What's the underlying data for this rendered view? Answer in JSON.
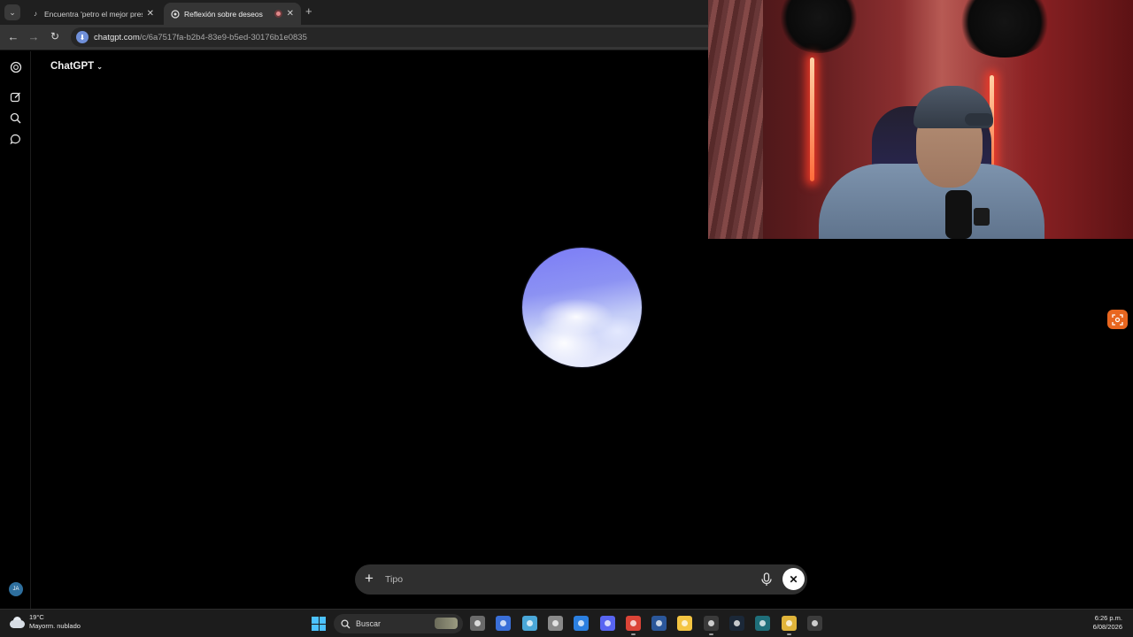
{
  "browser": {
    "tabs": [
      {
        "title": "Encuentra 'petro el mejor presi",
        "close": "✕",
        "active": false
      },
      {
        "title": "Reflexión sobre deseos",
        "close": "✕",
        "active": true
      }
    ],
    "new_tab": "+",
    "url_host": "chatgpt.com",
    "url_path": "/c/6a7517fa-b2b4-83e9-b5ed-30176b1e0835"
  },
  "app": {
    "model_label": "ChatGPT",
    "composer_placeholder": "Tipo",
    "avatar_initials": "JA",
    "orb_color": "#8a8ff5"
  },
  "taskbar": {
    "weather_temp": "19°C",
    "weather_desc": "Mayorm. nublado",
    "search_label": "Buscar",
    "apps": [
      {
        "name": "task-view",
        "icon": "task-view-icon",
        "color": "#6a6a6a"
      },
      {
        "name": "microsoft-store",
        "icon": "store-icon",
        "color": "#3a6fd8"
      },
      {
        "name": "photos",
        "icon": "photos-icon",
        "color": "#4aa7d8"
      },
      {
        "name": "settings",
        "icon": "gear-icon",
        "color": "#8a8a8a"
      },
      {
        "name": "defender",
        "icon": "shield-icon",
        "color": "#2b7fe0"
      },
      {
        "name": "discord",
        "icon": "discord-icon",
        "color": "#5865f2"
      },
      {
        "name": "chrome",
        "icon": "chrome-icon",
        "color": "#db4437"
      },
      {
        "name": "word",
        "icon": "word-icon",
        "color": "#2b579a"
      },
      {
        "name": "file-explorer",
        "icon": "folder-icon",
        "color": "#f4c542"
      },
      {
        "name": "chatgpt",
        "icon": "chatgpt-icon",
        "color": "#3a3a3a"
      },
      {
        "name": "steam",
        "icon": "steam-icon",
        "color": "#1b2838"
      },
      {
        "name": "app-blue",
        "icon": "app-icon",
        "color": "#1f6f7a"
      },
      {
        "name": "app-yellow",
        "icon": "pencil-icon",
        "color": "#e0b43a"
      },
      {
        "name": "media-player",
        "icon": "play-icon",
        "color": "#3c3c3c"
      }
    ],
    "time": "6:26 p.m.",
    "date": "6/08/2026"
  }
}
